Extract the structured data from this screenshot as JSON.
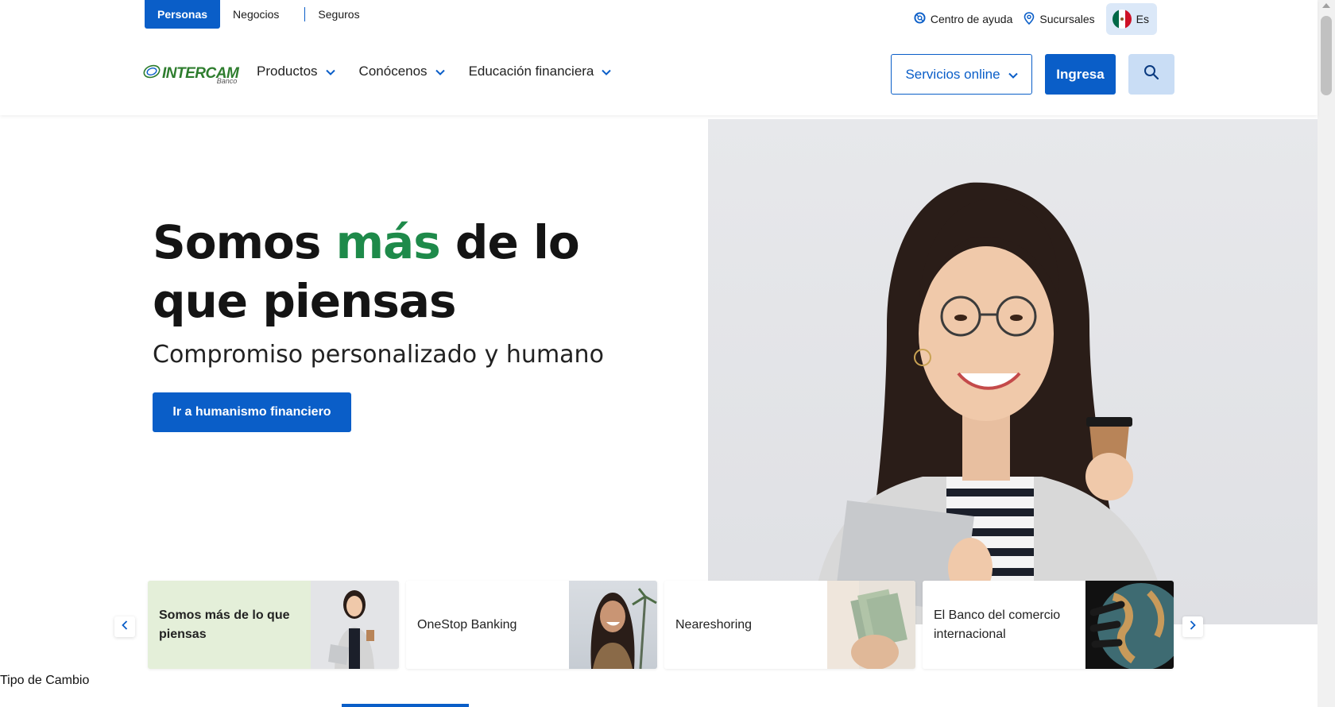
{
  "top_segments": {
    "personas": "Personas",
    "negocios": "Negocios",
    "seguros": "Seguros"
  },
  "utility": {
    "help": "Centro de ayuda",
    "branches": "Sucursales",
    "language": "Es"
  },
  "logo": {
    "name": "INTERCAM",
    "sub": "Banco"
  },
  "nav": {
    "products": "Productos",
    "about": "Conócenos",
    "education": "Educación financiera"
  },
  "actions": {
    "services": "Servicios online",
    "login": "Ingresa"
  },
  "hero": {
    "title_part1": "Somos ",
    "title_accent": "más",
    "title_part2": " de lo que piensas",
    "subtitle": "Compromiso personalizado y humano",
    "cta": "Ir a humanismo financiero"
  },
  "carousel": {
    "cards": [
      {
        "label": "Somos más de lo que piensas"
      },
      {
        "label": "OneStop Banking"
      },
      {
        "label": "Neareshoring"
      },
      {
        "label": "El Banco del comercio internacional"
      }
    ]
  },
  "footer": {
    "exchange": "Tipo de Cambio"
  },
  "colors": {
    "primary": "#0a5ec8",
    "accent_green": "#1e8a4a",
    "active_card": "#e4efd9"
  }
}
